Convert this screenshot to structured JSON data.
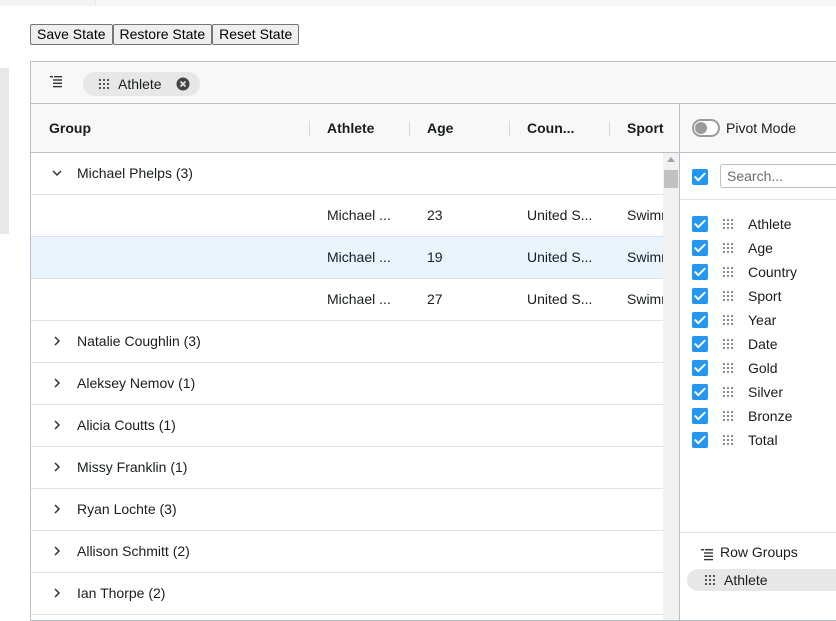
{
  "toolbar": {
    "save_label": "Save State",
    "restore_label": "Restore State",
    "reset_label": "Reset State"
  },
  "row_group_panel": {
    "chip_label": "Athlete"
  },
  "columns": {
    "group": "Group",
    "athlete": "Athlete",
    "age": "Age",
    "country": "Coun...",
    "sport": "Sport"
  },
  "rows": [
    {
      "type": "group",
      "label": "Michael Phelps (3)",
      "expanded": true
    },
    {
      "type": "leaf",
      "athlete": "Michael ...",
      "age": "23",
      "country": "United S...",
      "sport": "Swimr"
    },
    {
      "type": "leaf",
      "athlete": "Michael ...",
      "age": "19",
      "country": "United S...",
      "sport": "Swimr",
      "selected": true
    },
    {
      "type": "leaf",
      "athlete": "Michael ...",
      "age": "27",
      "country": "United S...",
      "sport": "Swimr"
    },
    {
      "type": "group",
      "label": "Natalie Coughlin (3)",
      "expanded": false
    },
    {
      "type": "group",
      "label": "Aleksey Nemov (1)",
      "expanded": false
    },
    {
      "type": "group",
      "label": "Alicia Coutts (1)",
      "expanded": false
    },
    {
      "type": "group",
      "label": "Missy Franklin (1)",
      "expanded": false
    },
    {
      "type": "group",
      "label": "Ryan Lochte (3)",
      "expanded": false
    },
    {
      "type": "group",
      "label": "Allison Schmitt (2)",
      "expanded": false
    },
    {
      "type": "group",
      "label": "Ian Thorpe (2)",
      "expanded": false
    }
  ],
  "side_panel": {
    "pivot_mode_label": "Pivot Mode",
    "search_placeholder": "Search...",
    "columns": [
      "Athlete",
      "Age",
      "Country",
      "Sport",
      "Year",
      "Date",
      "Gold",
      "Silver",
      "Bronze",
      "Total"
    ],
    "row_groups_title": "Row Groups",
    "row_group_item": "Athlete"
  },
  "colors": {
    "accent": "#2196f3",
    "selected_row": "#eaf4fd",
    "header_bg": "#f8f8f8",
    "border": "#babfc7"
  }
}
